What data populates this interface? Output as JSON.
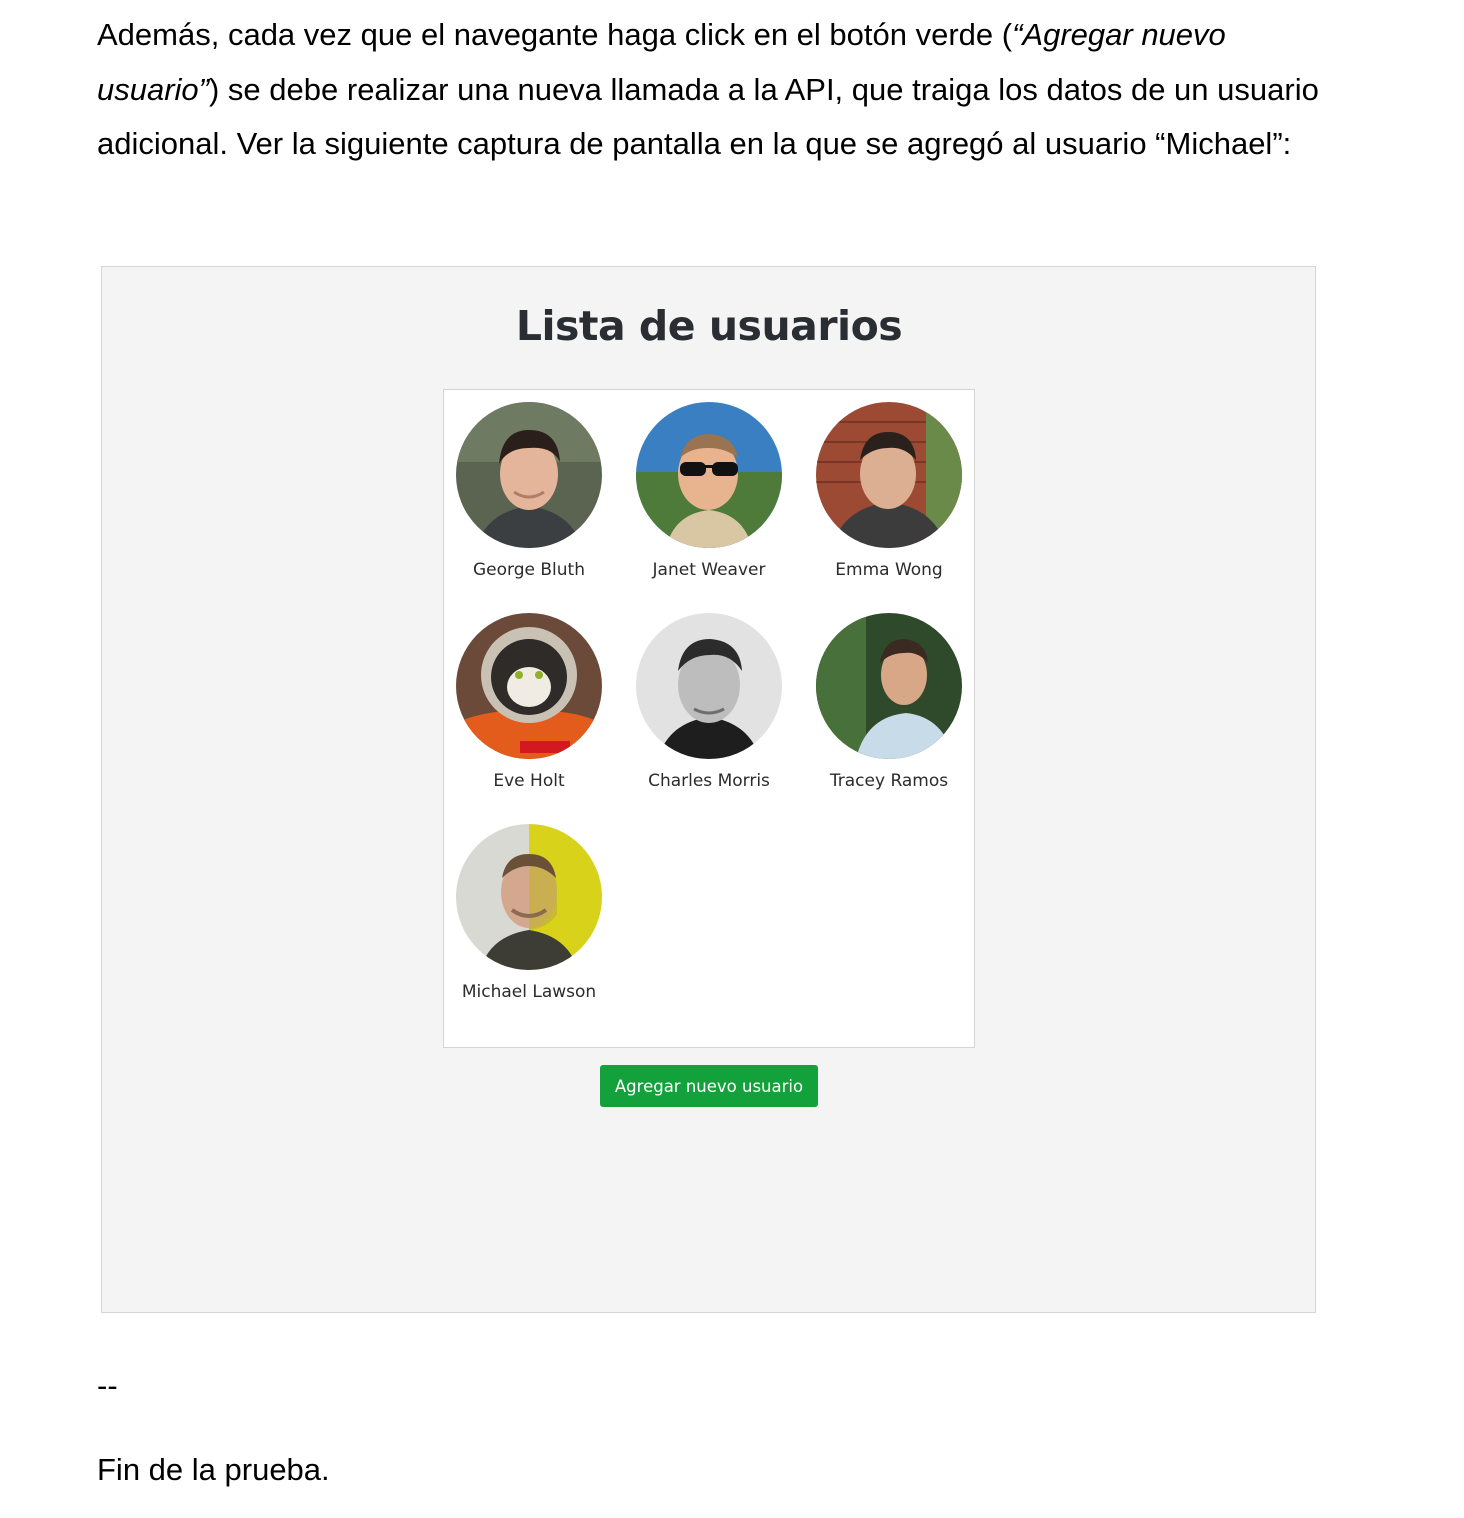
{
  "document": {
    "intro_1": "Además, cada vez que el navegante haga click en el botón verde (",
    "intro_italic": "“Agregar nuevo usuario”",
    "intro_2": ") se debe realizar una nueva llamada a la API, que traiga los datos de un usuario adicional. Ver la siguiente captura de pantalla en la que se agregó al usuario “Michael”:",
    "separator": "--",
    "closing": "Fin de la prueba."
  },
  "app": {
    "title": "Lista de usuarios",
    "add_button_label": "Agregar nuevo usuario",
    "users": [
      {
        "name": "George Bluth"
      },
      {
        "name": "Janet Weaver"
      },
      {
        "name": "Emma Wong"
      },
      {
        "name": "Eve Holt"
      },
      {
        "name": "Charles Morris"
      },
      {
        "name": "Tracey Ramos"
      },
      {
        "name": "Michael Lawson"
      }
    ]
  },
  "colors": {
    "button_green": "#12a13a",
    "panel_background": "#f4f4f4",
    "card_background": "#ffffff"
  }
}
